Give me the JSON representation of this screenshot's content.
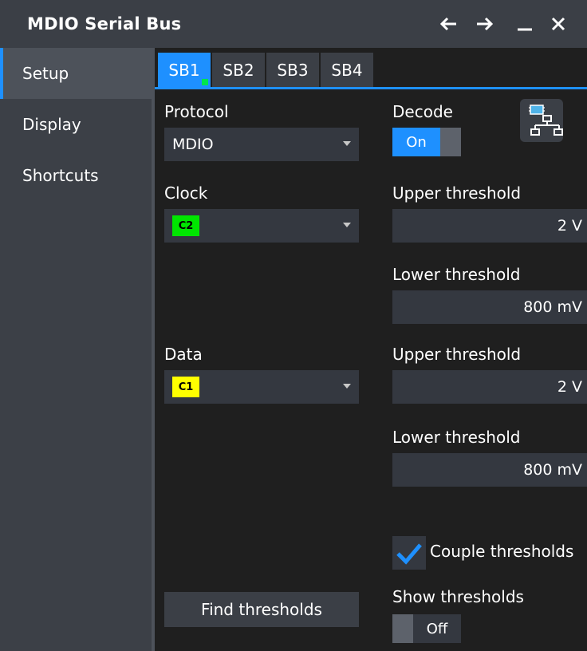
{
  "window": {
    "title": "MDIO Serial Bus",
    "controls": [
      "back-arrow",
      "forward-arrow",
      "minimize",
      "close"
    ]
  },
  "sidebar": {
    "items": [
      {
        "label": "Setup",
        "active": true
      },
      {
        "label": "Display",
        "active": false
      },
      {
        "label": "Shortcuts",
        "active": false
      }
    ]
  },
  "tabs": [
    {
      "label": "SB1",
      "active": true
    },
    {
      "label": "SB2",
      "active": false
    },
    {
      "label": "SB3",
      "active": false
    },
    {
      "label": "SB4",
      "active": false
    }
  ],
  "protocol": {
    "label": "Protocol",
    "value": "MDIO"
  },
  "decode": {
    "label": "Decode",
    "state": "On"
  },
  "clock": {
    "label": "Clock",
    "channel": "C2",
    "channel_color": "#00e600",
    "upper_label": "Upper threshold",
    "upper_value": "2 V",
    "lower_label": "Lower threshold",
    "lower_value": "800 mV"
  },
  "data_src": {
    "label": "Data",
    "channel": "C1",
    "channel_color": "#ffff00",
    "upper_label": "Upper threshold",
    "upper_value": "2 V",
    "lower_label": "Lower threshold",
    "lower_value": "800 mV"
  },
  "couple": {
    "label": "Couple thresholds",
    "checked": true
  },
  "show_thresholds": {
    "label": "Show thresholds",
    "state": "Off"
  },
  "find_thresholds": {
    "label": "Find thresholds"
  },
  "colors": {
    "accent": "#1e90ff",
    "background": "#1f1f1f",
    "panel": "#3b3f46"
  }
}
